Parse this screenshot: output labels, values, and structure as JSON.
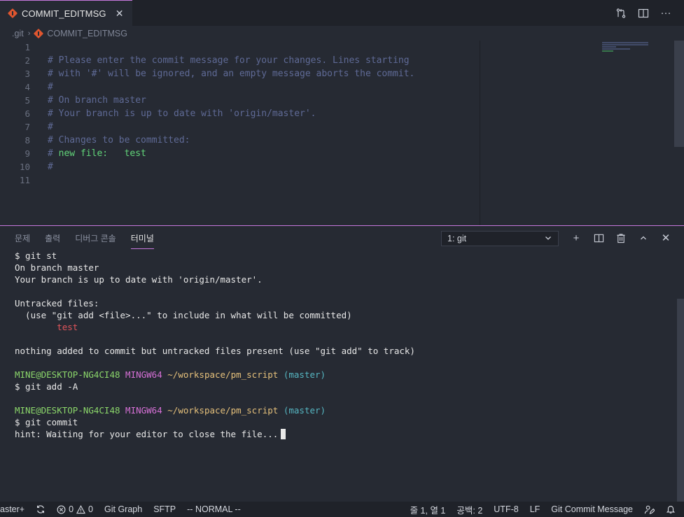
{
  "tab": {
    "label": "COMMIT_EDITMSG",
    "close": "✕"
  },
  "tab_actions": {
    "compare_icon": "⇄",
    "split_icon": "◫",
    "more_icon": "···"
  },
  "breadcrumb": {
    "folder": ".git",
    "file": "COMMIT_EDITMSG",
    "sep": "›"
  },
  "editor": {
    "line_numbers": [
      "1",
      "2",
      "3",
      "4",
      "5",
      "6",
      "7",
      "8",
      "9",
      "10",
      "11"
    ],
    "lines": [
      {
        "text": "",
        "style": "plain"
      },
      {
        "text": "# Please enter the commit message for your changes. Lines starting",
        "style": "comment"
      },
      {
        "text": "# with '#' will be ignored, and an empty message aborts the commit.",
        "style": "comment"
      },
      {
        "text": "#",
        "style": "comment"
      },
      {
        "text": "# On branch master",
        "style": "comment"
      },
      {
        "text": "# Your branch is up to date with 'origin/master'.",
        "style": "comment"
      },
      {
        "text": "#",
        "style": "comment"
      },
      {
        "text": "# Changes to be committed:",
        "style": "comment"
      },
      {
        "prefix": "# ",
        "text": "new file:   test",
        "style": "green"
      },
      {
        "text": "#",
        "style": "comment"
      },
      {
        "text": "",
        "style": "plain"
      }
    ]
  },
  "panel": {
    "tabs": [
      "문제",
      "출력",
      "디버그 콘솔",
      "터미널"
    ],
    "active_tab": "터미널",
    "terminal_select": "1: git",
    "actions": {
      "add": "+",
      "split": "◫",
      "trash": "🗑",
      "maximize": "^",
      "close": "✕"
    }
  },
  "terminal": {
    "l1": "$ git st",
    "l2": "On branch master",
    "l3": "Your branch is up to date with 'origin/master'.",
    "l4": "",
    "l5": "Untracked files:",
    "l6": "  (use \"git add <file>...\" to include in what will be committed)",
    "l7_indent": "        ",
    "l7": "test",
    "l8": "",
    "l9": "nothing added to commit but untracked files present (use \"git add\" to track)",
    "l10": "",
    "prompt_user": "MINE@DESKTOP-NG4CI48",
    "prompt_sys": "MINGW64",
    "prompt_path": "~/workspace/pm_script",
    "prompt_branch": "(master)",
    "l12": "$ git add -A",
    "l13": "",
    "l15": "$ git commit",
    "l16": "hint: Waiting for your editor to close the file..."
  },
  "statusbar": {
    "branch": "aster+",
    "sync_icon": "⟳",
    "errors": "0",
    "warnings": "0",
    "git_graph": "Git Graph",
    "sftp": "SFTP",
    "vim_mode": "-- NORMAL --",
    "position": "줄 1, 열 1",
    "spaces": "공백: 2",
    "encoding": "UTF-8",
    "eol": "LF",
    "language": "Git Commit Message"
  },
  "colors": {
    "accent": "#c678dd",
    "git_orange": "#e0562f",
    "comment": "#5f6a96",
    "green": "#62d67a"
  }
}
